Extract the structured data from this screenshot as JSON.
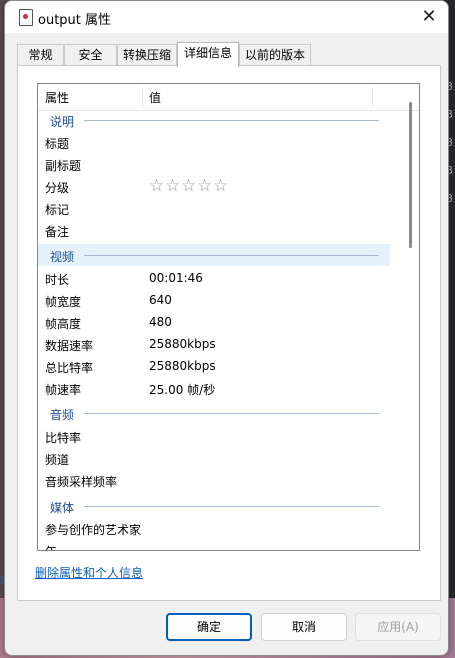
{
  "window": {
    "title": "output 属性",
    "close_glyph": "✕"
  },
  "tabs": [
    {
      "label": "常规",
      "active": false
    },
    {
      "label": "安全",
      "active": false
    },
    {
      "label": "转换压缩",
      "active": false
    },
    {
      "label": "详细信息",
      "active": true
    },
    {
      "label": "以前的版本",
      "active": false
    }
  ],
  "table": {
    "col_property": "属性",
    "col_value": "值"
  },
  "sections": {
    "description": {
      "label": "说明",
      "rows": [
        {
          "key": "标题",
          "value": ""
        },
        {
          "key": "副标题",
          "value": ""
        },
        {
          "key": "分级",
          "value": ""
        },
        {
          "key": "标记",
          "value": ""
        },
        {
          "key": "备注",
          "value": ""
        }
      ],
      "rating_stars": "☆☆☆☆☆",
      "rating_value": 0,
      "rating_max": 5
    },
    "video": {
      "label": "视频",
      "rows": [
        {
          "key": "时长",
          "value": "00:01:46"
        },
        {
          "key": "帧宽度",
          "value": "640"
        },
        {
          "key": "帧高度",
          "value": "480"
        },
        {
          "key": "数据速率",
          "value": "25880kbps"
        },
        {
          "key": "总比特率",
          "value": "25880kbps"
        },
        {
          "key": "帧速率",
          "value": "25.00 帧/秒"
        }
      ]
    },
    "audio": {
      "label": "音频",
      "rows": [
        {
          "key": "比特率",
          "value": ""
        },
        {
          "key": "频道",
          "value": ""
        },
        {
          "key": "音频采样频率",
          "value": ""
        }
      ]
    },
    "media": {
      "label": "媒体",
      "rows": [
        {
          "key": "参与创作的艺术家",
          "value": ""
        },
        {
          "key": "年",
          "value": ""
        }
      ]
    }
  },
  "remove_link": "删除属性和个人信息",
  "buttons": {
    "ok": "确定",
    "cancel": "取消",
    "apply": "应用(A)"
  },
  "background": {
    "left_fragment": "事",
    "right_fragment": "3"
  }
}
